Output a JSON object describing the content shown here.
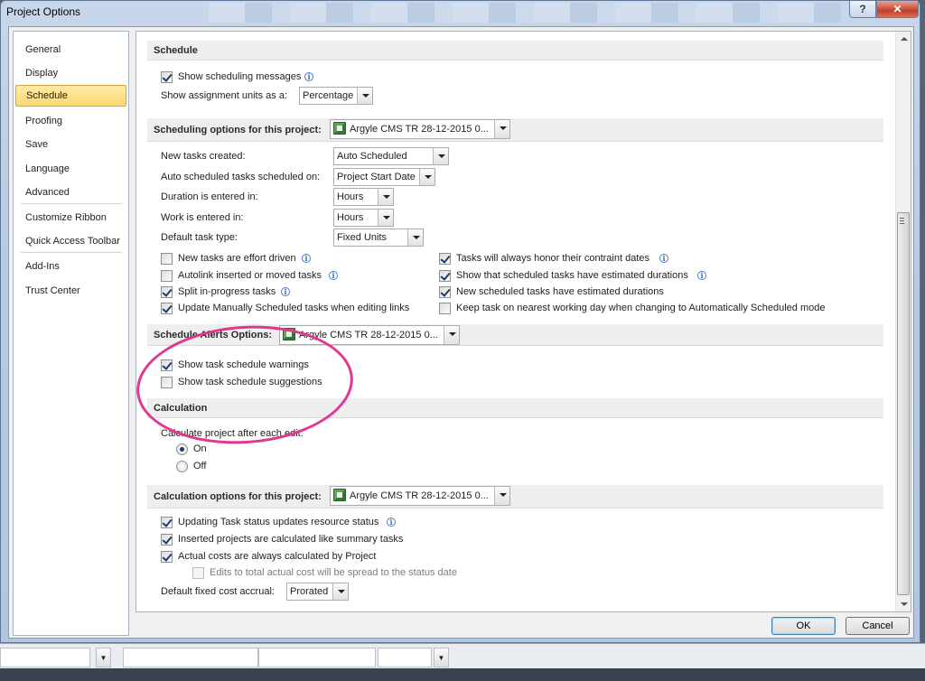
{
  "window": {
    "title": "Project Options",
    "help": "?",
    "close": "✕"
  },
  "nav": {
    "items": [
      {
        "label": "General"
      },
      {
        "label": "Display"
      },
      {
        "label": "Schedule"
      },
      {
        "label": "Proofing"
      },
      {
        "label": "Save"
      },
      {
        "label": "Language"
      },
      {
        "label": "Advanced"
      },
      {
        "label": "Customize Ribbon"
      },
      {
        "label": "Quick Access Toolbar"
      },
      {
        "label": "Add-Ins"
      },
      {
        "label": "Trust Center"
      }
    ],
    "active": "Schedule"
  },
  "schedule": {
    "header": "Schedule",
    "show_messages": {
      "label": "Show scheduling messages",
      "checked": true
    },
    "assignment_units": {
      "label": "Show assignment units as a:",
      "value": "Percentage"
    }
  },
  "scheduling_options": {
    "header": "Scheduling options for this project:",
    "project": "Argyle CMS TR 28-12-2015 0...",
    "new_tasks": {
      "label": "New tasks created:",
      "value": "Auto Scheduled"
    },
    "auto_scheduled": {
      "label": "Auto scheduled tasks scheduled on:",
      "value": "Project Start Date"
    },
    "duration": {
      "label": "Duration is entered in:",
      "value": "Hours"
    },
    "work": {
      "label": "Work is entered in:",
      "value": "Hours"
    },
    "task_type": {
      "label": "Default task type:",
      "value": "Fixed Units"
    },
    "checks_left": [
      {
        "label": "New tasks are effort driven",
        "checked": false,
        "info": true
      },
      {
        "label": "Autolink inserted or moved tasks",
        "checked": false,
        "info": true
      },
      {
        "label": "Split in-progress tasks",
        "checked": true,
        "info": true
      },
      {
        "label": "Update Manually Scheduled tasks when editing links",
        "checked": true,
        "info": false
      }
    ],
    "checks_right": [
      {
        "label": "Tasks will always honor their contraint dates",
        "checked": true,
        "info": true
      },
      {
        "label": "Show that scheduled tasks have estimated durations",
        "checked": true,
        "info": true
      },
      {
        "label": "New scheduled tasks have estimated durations",
        "checked": true,
        "info": false
      },
      {
        "label": "Keep task on nearest working day when changing to Automatically Scheduled mode",
        "checked": false,
        "info": false
      }
    ]
  },
  "alerts": {
    "header": "Schedule Alerts Options:",
    "project": "Argyle CMS TR 28-12-2015 0...",
    "warnings": {
      "label": "Show task schedule warnings",
      "checked": true
    },
    "suggestions": {
      "label": "Show task schedule suggestions",
      "checked": false
    }
  },
  "calculation": {
    "header": "Calculation",
    "prompt": "Calculate project after each edit:",
    "on": {
      "label": "On",
      "selected": true
    },
    "off": {
      "label": "Off",
      "selected": false
    }
  },
  "calc_options": {
    "header": "Calculation options for this project:",
    "project": "Argyle CMS TR 28-12-2015 0...",
    "updating": {
      "label": "Updating Task status updates resource status",
      "checked": true
    },
    "inserted": {
      "label": "Inserted projects are calculated like summary tasks",
      "checked": true
    },
    "actual": {
      "label": "Actual costs are always calculated by Project",
      "checked": true
    },
    "edits": {
      "label": "Edits to total actual cost will be spread to the status date",
      "checked": false
    },
    "fixed_cost": {
      "label": "Default fixed cost accrual:",
      "value": "Prorated"
    }
  },
  "buttons": {
    "ok": "OK",
    "cancel": "Cancel"
  },
  "colors": {
    "accent": "#fbd96f",
    "annotation": "#e0378f",
    "ok_focus": "#3c7fb1"
  }
}
